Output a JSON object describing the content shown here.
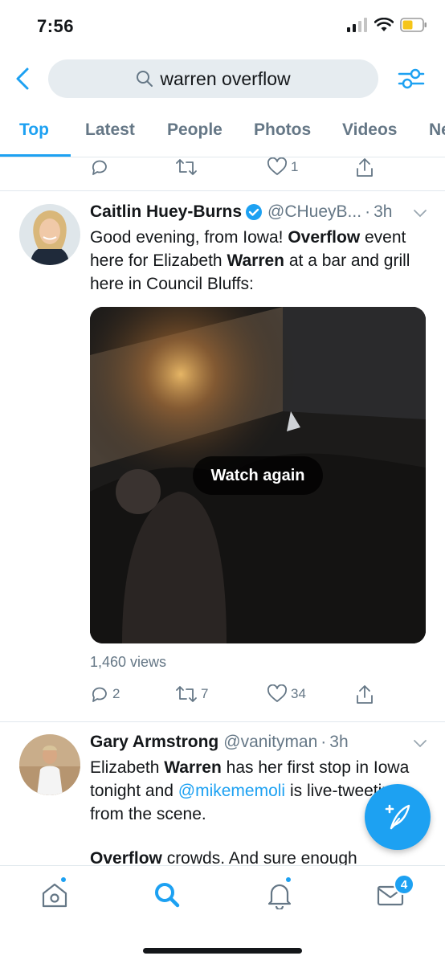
{
  "status_bar": {
    "time": "7:56",
    "battery_color": "#f5c518"
  },
  "search": {
    "query": "warren overflow"
  },
  "tabs": [
    {
      "label": "Top",
      "active": true
    },
    {
      "label": "Latest",
      "active": false
    },
    {
      "label": "People",
      "active": false
    },
    {
      "label": "Photos",
      "active": false
    },
    {
      "label": "Videos",
      "active": false
    },
    {
      "label": "Ne",
      "active": false
    }
  ],
  "prev_tweet_actions": {
    "likes": "1"
  },
  "tweets": [
    {
      "author": "Caitlin Huey-Burns",
      "verified": true,
      "handle": "@CHueyB...",
      "sep": "·",
      "time": "3h",
      "text_parts": [
        "Good evening, from Iowa! ",
        "Overflow",
        " event here for Elizabeth ",
        "Warren",
        " at a bar and grill here in Council Bluffs:"
      ],
      "video_button": "Watch again",
      "views": "1,460 views",
      "replies": "2",
      "retweets": "7",
      "likes": "34"
    },
    {
      "author": "Gary Armstrong",
      "handle": "@vanityman",
      "sep": "·",
      "time": "3h",
      "text_parts": [
        "Elizabeth ",
        "Warren",
        " has her first stop in Iowa tonight and ",
        "@mikememoli",
        " is live-tweeting from the scene.",
        "Overflow",
        " crowds. And sure enough"
      ]
    }
  ],
  "bottom_nav": {
    "items": [
      {
        "icon": "home-icon",
        "active": false,
        "dot": true
      },
      {
        "icon": "search-icon",
        "active": true,
        "dot": false
      },
      {
        "icon": "bell-icon",
        "active": false,
        "dot": true
      },
      {
        "icon": "mail-icon",
        "active": false,
        "badge": "4"
      }
    ]
  },
  "colors": {
    "accent": "#1da1f2",
    "secondary_text": "#657786"
  }
}
